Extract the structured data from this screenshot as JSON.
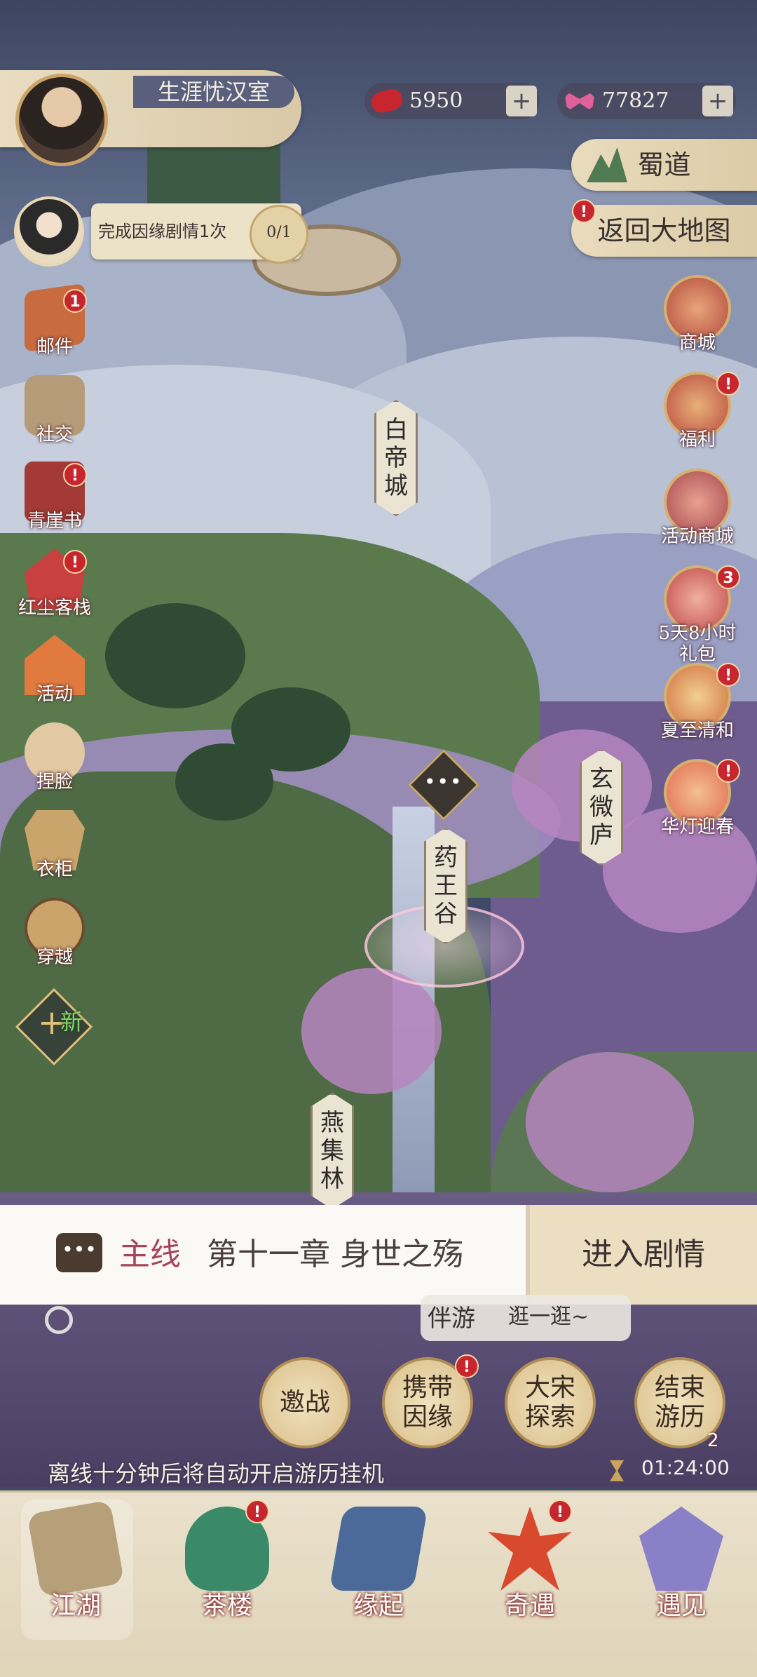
{
  "player": {
    "name": "生涯忧汉室"
  },
  "currency": {
    "red_amount": "5950",
    "pink_amount": "77827",
    "plus": "+"
  },
  "right_pills": {
    "region": "蜀道",
    "return_map": "返回大地图"
  },
  "quest": {
    "text": "完成因缘剧情1次",
    "progress": "0/1"
  },
  "left_menu": [
    {
      "label": "邮件",
      "badge": "1"
    },
    {
      "label": "社交"
    },
    {
      "label": "青崖书",
      "badge": "!"
    },
    {
      "label": "红尘客栈",
      "badge": "!"
    },
    {
      "label": "活动"
    },
    {
      "label": "捏脸"
    },
    {
      "label": "衣柜"
    },
    {
      "label": "穿越"
    }
  ],
  "new_button": {
    "plus": "+",
    "label": "新"
  },
  "right_menu": [
    {
      "label": "商城"
    },
    {
      "label": "福利",
      "badge": "!"
    },
    {
      "label": "活动商城"
    },
    {
      "label_line1": "5天8小时",
      "label_line2": "礼包",
      "badge": "3"
    },
    {
      "label": "夏至清和",
      "badge": "!"
    },
    {
      "label": "华灯迎春",
      "badge": "!"
    }
  ],
  "map_locations": {
    "baidi": "白帝城",
    "yaowang": "药王谷",
    "xuanwei": "玄微庐",
    "yanji": "燕集林"
  },
  "chat_dots": "•••",
  "story": {
    "tag": "主线",
    "title": "第十一章 身世之殇",
    "enter": "进入剧情",
    "icon_dots": "•••"
  },
  "companion": {
    "tag": "伴游",
    "text": "逛一逛~"
  },
  "actions": [
    {
      "label": "邀战"
    },
    {
      "label": "携带因缘",
      "badge": "!"
    },
    {
      "label": "大宋探索"
    },
    {
      "label": "结束游历",
      "count": "2"
    }
  ],
  "afk": {
    "text": "离线十分钟后将自动开启游历挂机",
    "timer": "01:24:00"
  },
  "bottom_nav": [
    {
      "label": "江湖",
      "active": true
    },
    {
      "label": "茶楼",
      "badge": "!"
    },
    {
      "label": "缘起"
    },
    {
      "label": "奇遇",
      "badge": "!"
    },
    {
      "label": "遇见"
    }
  ]
}
